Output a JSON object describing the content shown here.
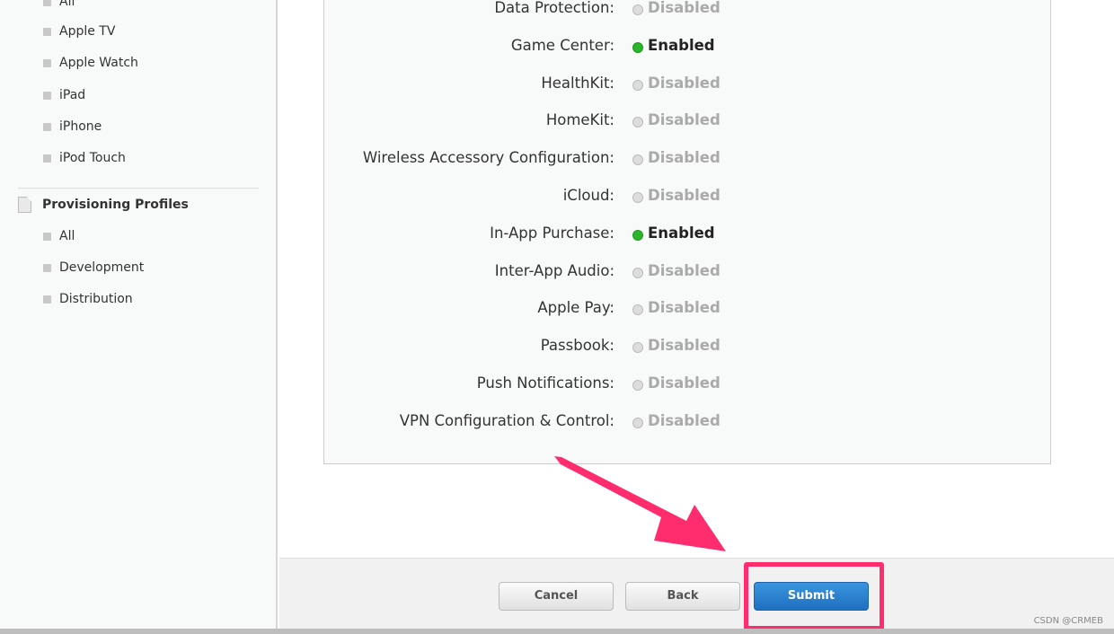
{
  "sidebar": {
    "devices": [
      "All",
      "Apple TV",
      "Apple Watch",
      "iPad",
      "iPhone",
      "iPod Touch"
    ],
    "profiles_title": "Provisioning Profiles",
    "profiles": [
      "All",
      "Development",
      "Distribution"
    ]
  },
  "services": [
    {
      "label": "Data Protection:",
      "status": "Disabled",
      "enabled": false
    },
    {
      "label": "Game Center:",
      "status": "Enabled",
      "enabled": true
    },
    {
      "label": "HealthKit:",
      "status": "Disabled",
      "enabled": false
    },
    {
      "label": "HomeKit:",
      "status": "Disabled",
      "enabled": false
    },
    {
      "label": "Wireless Accessory Configuration:",
      "status": "Disabled",
      "enabled": false
    },
    {
      "label": "iCloud:",
      "status": "Disabled",
      "enabled": false
    },
    {
      "label": "In-App Purchase:",
      "status": "Enabled",
      "enabled": true
    },
    {
      "label": "Inter-App Audio:",
      "status": "Disabled",
      "enabled": false
    },
    {
      "label": "Apple Pay:",
      "status": "Disabled",
      "enabled": false
    },
    {
      "label": "Passbook:",
      "status": "Disabled",
      "enabled": false
    },
    {
      "label": "Push Notifications:",
      "status": "Disabled",
      "enabled": false
    },
    {
      "label": "VPN Configuration & Control:",
      "status": "Disabled",
      "enabled": false
    }
  ],
  "footer": {
    "cancel": "Cancel",
    "back": "Back",
    "submit": "Submit"
  },
  "annotation": {
    "color": "#ff2d6e"
  },
  "watermark": "CSDN @CRMEB"
}
